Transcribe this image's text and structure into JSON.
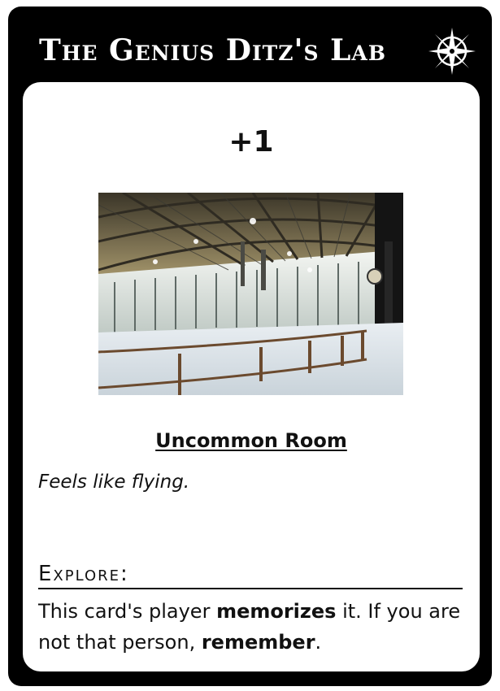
{
  "card": {
    "title": "The Genius Ditz's Lab",
    "emblem_icon": "compass-star-icon",
    "cost": "+1",
    "image_alt": "indoor-ice-rink-photo",
    "room_type": "Uncommon Room",
    "flavor_text": "Feels like flying.",
    "ability": {
      "heading": "Explore:",
      "parts": [
        {
          "text": "This card's player ",
          "bold": false
        },
        {
          "text": "memorizes",
          "bold": true
        },
        {
          "text": " it. If you are not that person, ",
          "bold": false
        },
        {
          "text": "remember",
          "bold": true
        },
        {
          "text": ".",
          "bold": false
        }
      ]
    }
  },
  "colors": {
    "frame": "#000000",
    "panel": "#ffffff",
    "text": "#111111"
  }
}
